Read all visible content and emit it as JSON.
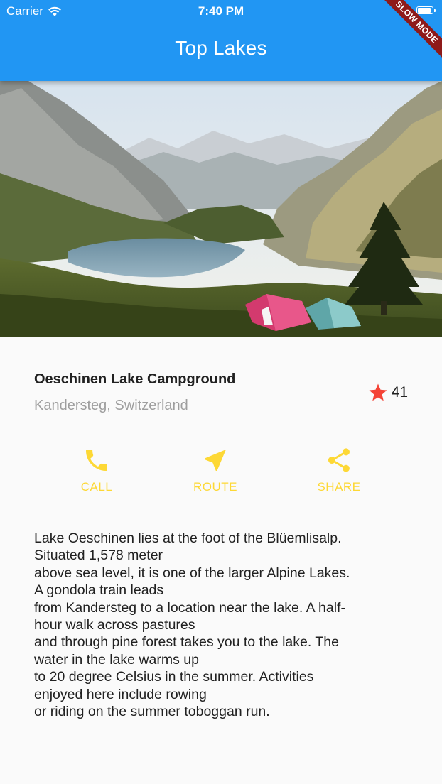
{
  "status_bar": {
    "carrier": "Carrier",
    "time": "7:40 PM",
    "wifi_icon": "wifi-icon",
    "battery_icon": "battery-icon"
  },
  "app_bar": {
    "title": "Top Lakes",
    "color": "#2196f3"
  },
  "debug_banner": {
    "label": "SLOW MODE",
    "color": "#8e1a1a"
  },
  "hero_image": {
    "subject": "mountain lake with tents"
  },
  "title_section": {
    "name": "Oeschinen Lake Campground",
    "location": "Kandersteg, Switzerland",
    "rating_icon": "star-icon",
    "rating_color": "#f44336",
    "rating_count": "41"
  },
  "buttons": {
    "accent_color": "#fdd835",
    "items": [
      {
        "label": "CALL",
        "icon": "phone-icon"
      },
      {
        "label": "ROUTE",
        "icon": "navigation-icon"
      },
      {
        "label": "SHARE",
        "icon": "share-icon"
      }
    ]
  },
  "description": {
    "lines": [
      "Lake Oeschinen lies at the foot of the Blüemlisalp.",
      "Situated 1,578 meter",
      "above sea level, it is one of the larger Alpine Lakes.",
      "A gondola train leads",
      "from Kandersteg to a location near the lake. A half-",
      "hour walk across pastures",
      "and through pine forest takes you to the lake. The",
      "water in the lake warms up",
      "to 20 degree Celsius in the summer. Activities",
      "enjoyed here include rowing",
      "or riding on the summer toboggan run."
    ]
  }
}
